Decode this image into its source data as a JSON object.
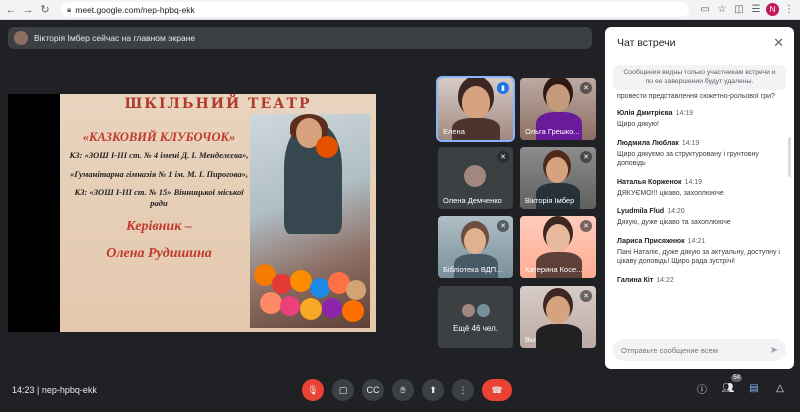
{
  "browser": {
    "url": "meet.google.com/nep-hpbq-ekk",
    "profile_initial": "N"
  },
  "presenter": {
    "notice": "Вікторія Імбер сейчас на главном экране"
  },
  "slide": {
    "title": "ШКІЛЬНИЙ ТЕАТР",
    "name": "«КАЗКОВИЙ КЛУБОЧОК»",
    "schools": [
      "КЗ: «ЗОШ І-ІІІ ст. № 4 імені Д. І. Менделєєва»,",
      "«Гуманітарна гімназія № 1 ім. М. І. Пирогова»,",
      "КЗ: «ЗОШ І-ІІІ ст. № 15» Вінницької міської ради"
    ],
    "leader_label": "Керівник –",
    "leader_name": "Олена Рудишина"
  },
  "participants": [
    {
      "name": "Елена",
      "speaking": true
    },
    {
      "name": "Ольга Грешко...",
      "speaking": false
    },
    {
      "name": "Олена Демченко",
      "speaking": false
    },
    {
      "name": "Вікторія Імбер",
      "speaking": false
    },
    {
      "name": "Бібліотека ВДП...",
      "speaking": false
    },
    {
      "name": "Катерина Косе...",
      "speaking": false
    },
    {
      "name": "Ещё 46 чел.",
      "speaking": false
    },
    {
      "name": "Вы",
      "speaking": false
    }
  ],
  "chat": {
    "title": "Чат встречи",
    "notice": "Сообщения видны только участникам встречи и по ее завершении будут удалены.",
    "cut_text": "провести представлення сюжетно-рольової гри?",
    "messages": [
      {
        "author": "Юлія Дмитрієва",
        "time": "14:19",
        "text": "Щиро дякую!"
      },
      {
        "author": "Людмила Люблак",
        "time": "14:19",
        "text": "Щиро дякуємо за структуровану і грунтовну доповідь"
      },
      {
        "author": "Наталья Корженок",
        "time": "14:19",
        "text": "ДЯКУЄМО!!! цікаво, захоплююче"
      },
      {
        "author": "Lyudmila Flud",
        "time": "14:20",
        "text": "Дякую, дуже цікаво та захоплююче"
      },
      {
        "author": "Лариса Присяжнюк",
        "time": "14:21",
        "text": "Пані Наталіє, дуже дякую за актуальну, доступну і цікаву доповідь! Щиро рада зустрічі!"
      },
      {
        "author": "Галина Кіт",
        "time": "14:22",
        "text": ""
      }
    ],
    "input_placeholder": "Отправьте сообщение всем"
  },
  "meeting": {
    "time": "14:23",
    "code": "nep-hpbq-ekk",
    "participant_count": "54"
  },
  "colors": {
    "end_call": "#ea4335",
    "accent": "#8ab4f8",
    "background": "#202124"
  }
}
